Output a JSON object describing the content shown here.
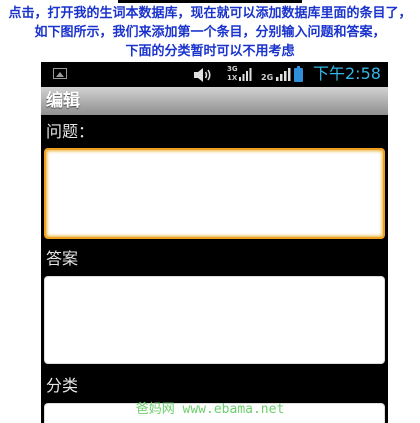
{
  "caption": {
    "line1": "点击，打开我的生词本数据库，现在就可以添加数据库里面的条目了，",
    "line2": "如下图所示，我们来添加第一个条目，分别输入问题和答案，",
    "line3": "下面的分类暂时可以不用考虑"
  },
  "statusbar": {
    "net1_top": "3G",
    "net1_bottom": "1X",
    "net2": "2G",
    "time": "下午2:58",
    "accent_color": "#33b5e5",
    "icons": [
      "picture-icon",
      "speaker-icon",
      "signal-icon",
      "battery-icon"
    ]
  },
  "app": {
    "title": "编辑",
    "question_label": "问题：",
    "answer_label": "答案",
    "category_label": "分类"
  },
  "fields": {
    "question_value": "",
    "answer_value": "",
    "category_value": ""
  },
  "watermark": "爸妈网 www.ebama.net",
  "colors": {
    "caption": "#1a33cc",
    "focus_border": "#f0a020",
    "watermark": "#6fcf6f"
  }
}
